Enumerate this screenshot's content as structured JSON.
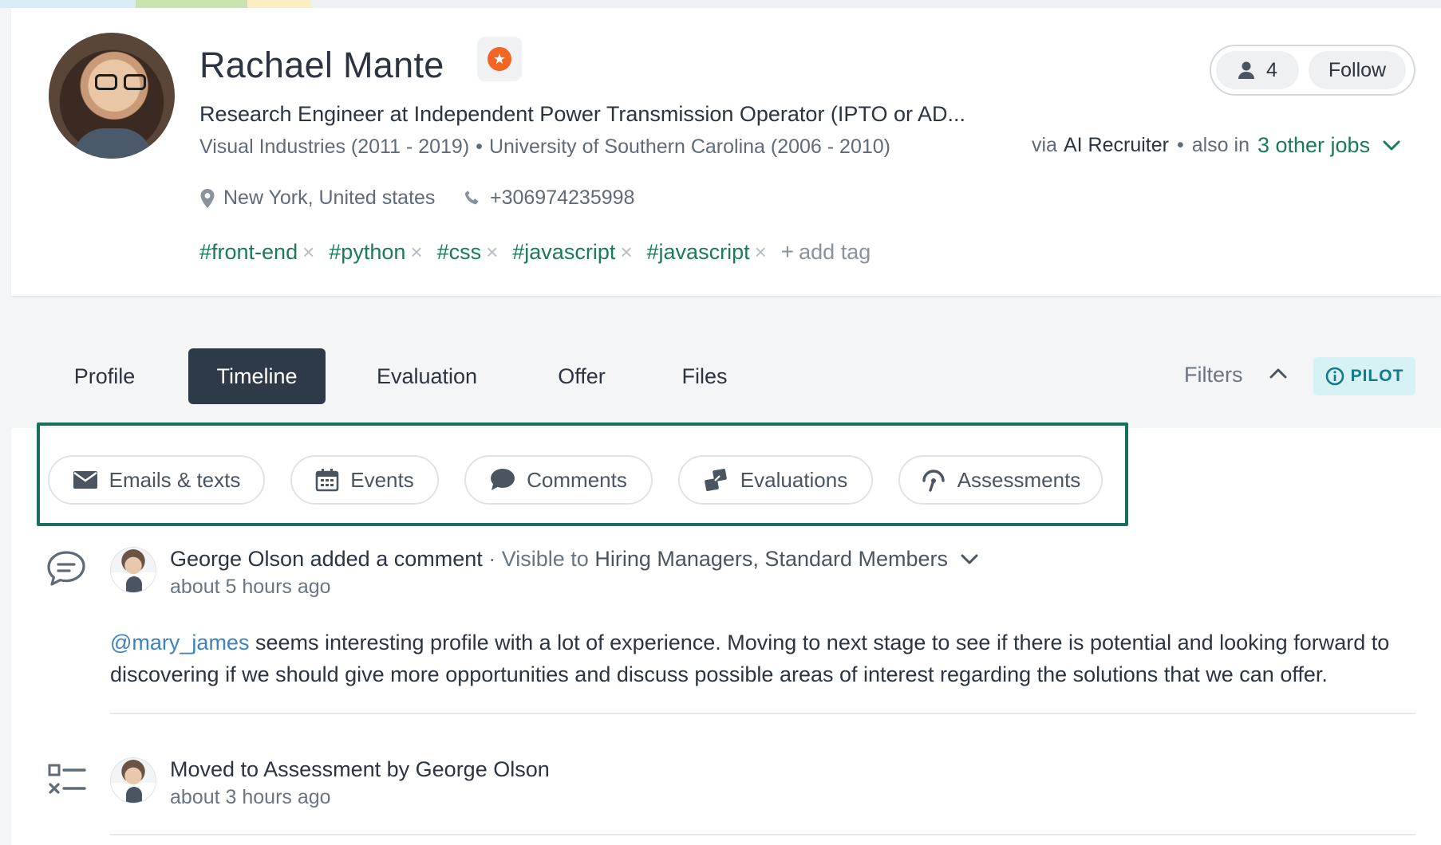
{
  "candidate": {
    "name": "Rachael Mante",
    "headline": "Research Engineer at Independent Power Transmission Operator (IPTO or AD...",
    "experience": "Visual Industries (2011 - 2019)",
    "education": "University of Southern Carolina (2006 - 2010)",
    "separator": "•",
    "location": "New York, United states",
    "phone": "+306974235998",
    "tags": [
      "#front-end",
      "#python",
      "#css",
      "#javascript",
      "#javascript"
    ],
    "add_tag_label": "add tag"
  },
  "follow": {
    "followers_count": "4",
    "follow_label": "Follow"
  },
  "source": {
    "via_label": "via",
    "source_name": "AI Recruiter",
    "dot": "•",
    "also_in_label": "also in",
    "other_jobs_label": "3 other jobs"
  },
  "tabs": {
    "items": [
      {
        "label": "Profile"
      },
      {
        "label": "Timeline"
      },
      {
        "label": "Evaluation"
      },
      {
        "label": "Offer"
      },
      {
        "label": "Files"
      }
    ],
    "active": "Timeline",
    "filters_label": "Filters",
    "pilot_label": "PILOT"
  },
  "filter_chips": [
    {
      "label": "Emails & texts",
      "icon": "envelope-icon"
    },
    {
      "label": "Events",
      "icon": "calendar-icon"
    },
    {
      "label": "Comments",
      "icon": "comment-bubble-icon"
    },
    {
      "label": "Evaluations",
      "icon": "evaluation-icon"
    },
    {
      "label": "Assessments",
      "icon": "assessment-icon"
    }
  ],
  "timeline": [
    {
      "icon": "comment-icon",
      "author": "George Olson",
      "action": "added a comment",
      "visible_prefix": "· Visible to",
      "visible_to": "Hiring Managers, Standard Members",
      "time": "about 5 hours ago",
      "mention": "@mary_james",
      "body": " seems interesting profile with a lot of experience. Moving to next stage to see if there is potential and looking forward to discovering if we should give more opportunities and discuss possible areas of interest regarding the solutions that we can offer."
    },
    {
      "icon": "checklist-icon",
      "action": "Moved to Assessment by",
      "author": "George Olson",
      "time": "about 3 hours ago"
    }
  ],
  "colors": {
    "accent_green": "#1a7a5e",
    "tab_active_bg": "#2e3a47",
    "star_badge": "#f26522",
    "pilot_bg": "#d6f2f4",
    "pilot_text": "#127a8a",
    "mention": "#3b82c4"
  }
}
